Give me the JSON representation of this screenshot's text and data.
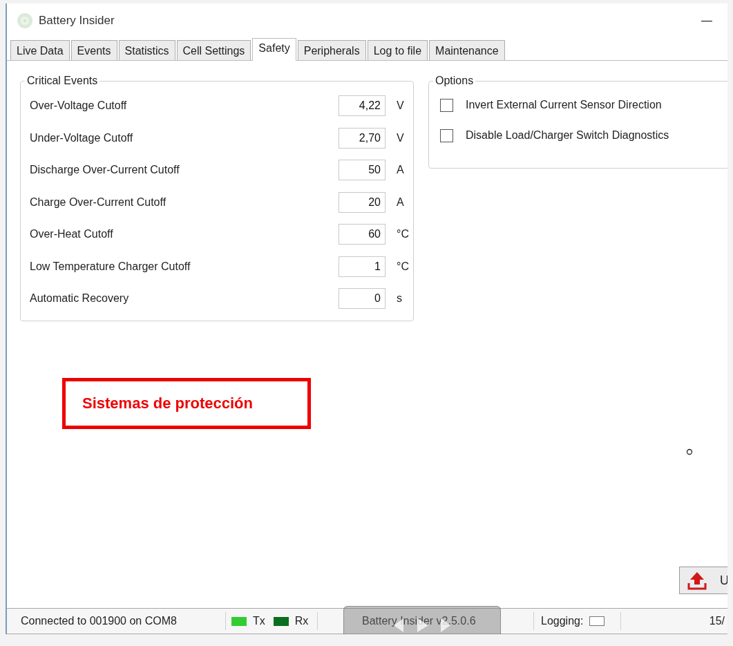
{
  "window": {
    "title": "Battery Insider",
    "minimize": "—"
  },
  "tabs": [
    {
      "label": "Live Data",
      "selected": false
    },
    {
      "label": "Events",
      "selected": false
    },
    {
      "label": "Statistics",
      "selected": false
    },
    {
      "label": "Cell Settings",
      "selected": false
    },
    {
      "label": "Safety",
      "selected": true
    },
    {
      "label": "Peripherals",
      "selected": false
    },
    {
      "label": "Log to file",
      "selected": false
    },
    {
      "label": "Maintenance",
      "selected": false
    }
  ],
  "critical_events": {
    "title": "Critical Events",
    "rows": [
      {
        "label": "Over-Voltage Cutoff",
        "value": "4,22",
        "unit": "V"
      },
      {
        "label": "Under-Voltage Cutoff",
        "value": "2,70",
        "unit": "V"
      },
      {
        "label": "Discharge Over-Current Cutoff",
        "value": "50",
        "unit": "A"
      },
      {
        "label": "Charge Over-Current Cutoff",
        "value": "20",
        "unit": "A"
      },
      {
        "label": "Over-Heat Cutoff",
        "value": "60",
        "unit": "°C"
      },
      {
        "label": "Low Temperature Charger Cutoff",
        "value": "1",
        "unit": "°C"
      },
      {
        "label": "Automatic Recovery",
        "value": "0",
        "unit": "s"
      }
    ]
  },
  "options": {
    "title": "Options",
    "items": [
      {
        "label": "Invert External Current Sensor Direction",
        "checked": false
      },
      {
        "label": "Disable Load/Charger Switch Diagnostics",
        "checked": false
      }
    ]
  },
  "annotation": "Sistemas de protección",
  "upload_button": "U",
  "status_bar": {
    "connection": "Connected to 001900 on COM8",
    "indicators": [
      {
        "label": "Tx",
        "color": "#33cc33"
      },
      {
        "label": "Rx",
        "color": "#0a6e1e"
      }
    ],
    "version": "Battery Insider v2.5.0.6",
    "logging": {
      "label": "Logging:",
      "checked": false
    },
    "date": "15/"
  }
}
